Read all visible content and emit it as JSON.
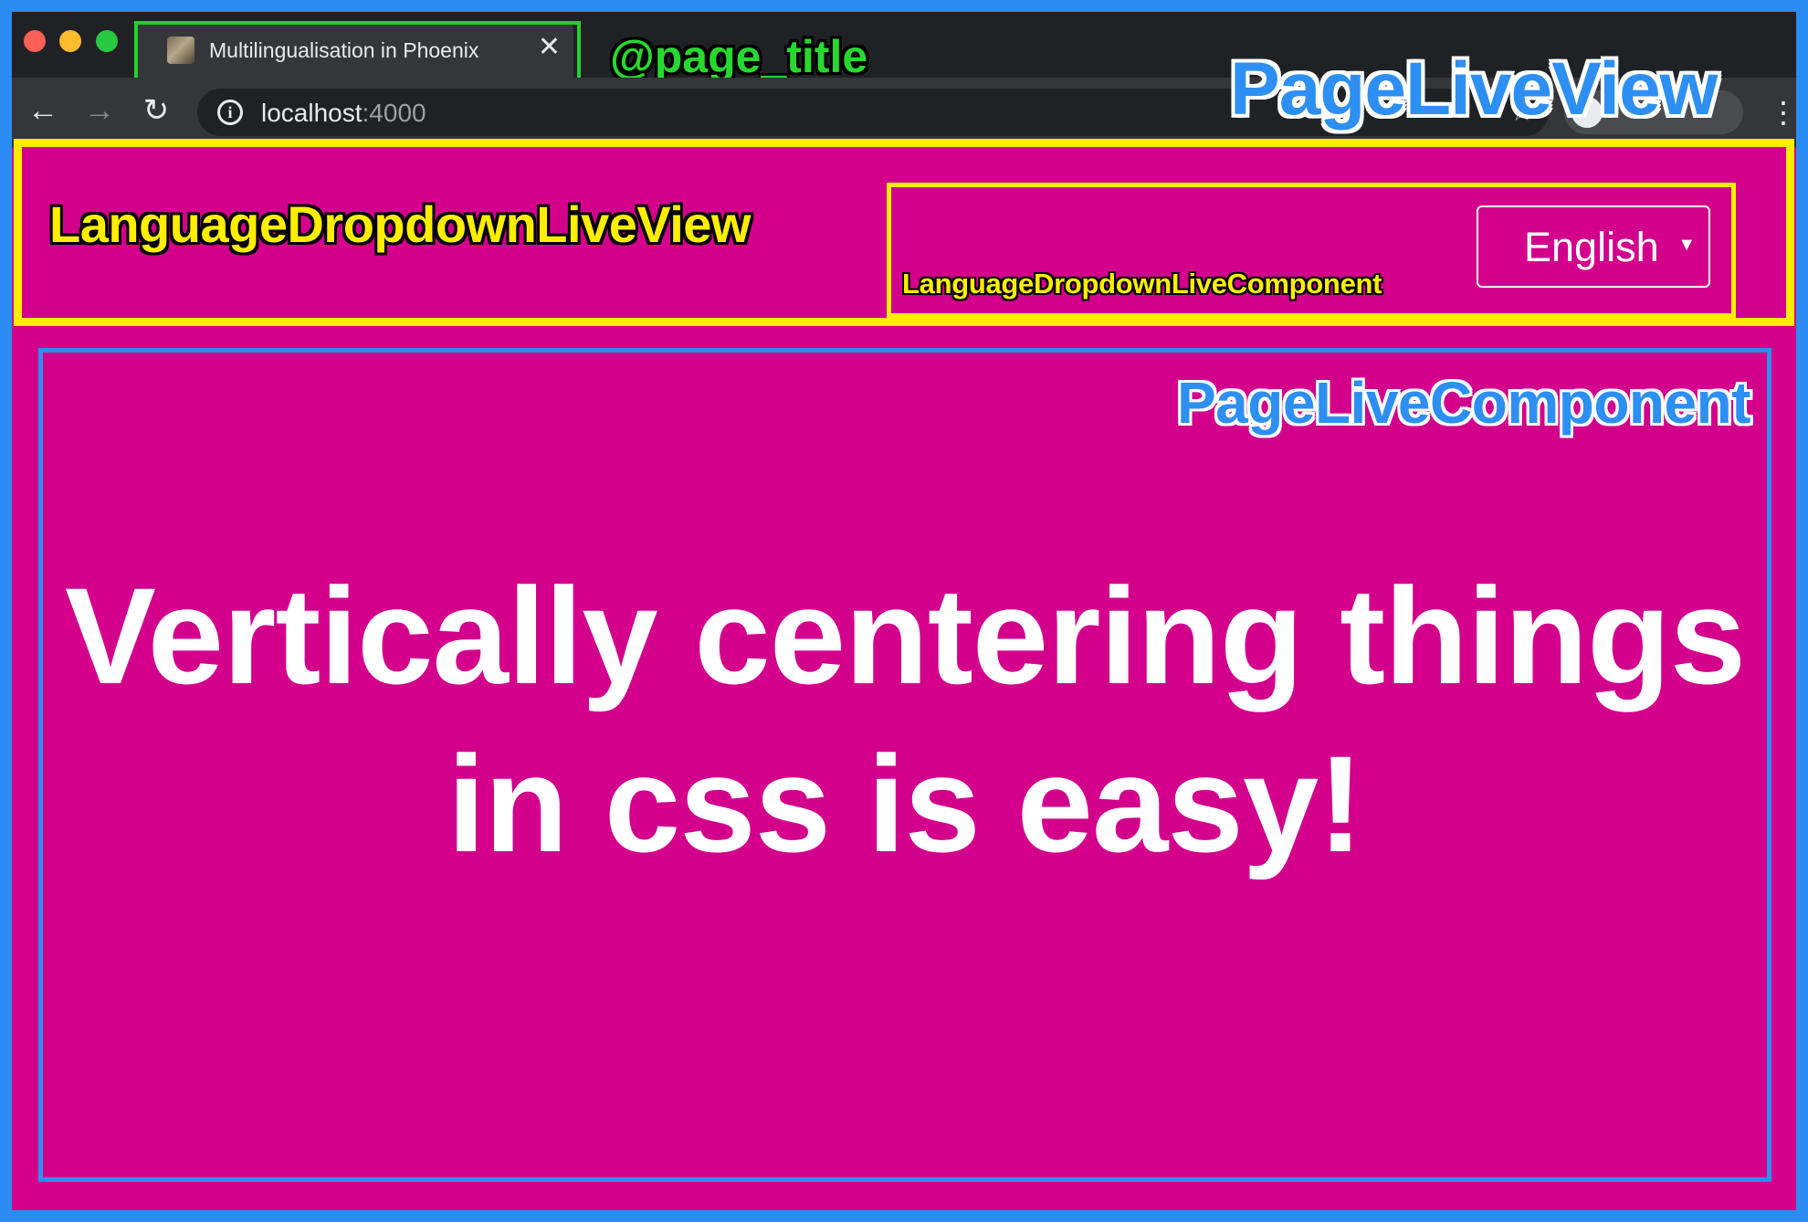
{
  "browser": {
    "tab": {
      "title": "Multilingualisation in Phoenix",
      "close_glyph": "✕",
      "favicon": "page-favicon"
    },
    "nav": {
      "back_glyph": "←",
      "forward_glyph": "→",
      "reload_glyph": "↻"
    },
    "address": {
      "host": "localhost",
      "port": ":4000",
      "info_glyph": "i"
    },
    "menu_glyph": "⋮",
    "star_glyph": "☆"
  },
  "annotations": {
    "page_title": "@page_title",
    "page_live_view": "PageLiveView",
    "language_dropdown_live_view": "LanguageDropdownLiveView",
    "language_dropdown_live_component": "LanguageDropdownLiveComponent",
    "page_live_component": "PageLiveComponent"
  },
  "language_dropdown": {
    "selected": "English",
    "caret": "▼"
  },
  "content": {
    "headline": "Vertically centering things in css is easy!"
  },
  "colors": {
    "page_background": "#d3008c",
    "frame_blue": "#2a8cf0",
    "liveview_yellow": "#ffee00",
    "page_title_green": "#22d22a"
  }
}
